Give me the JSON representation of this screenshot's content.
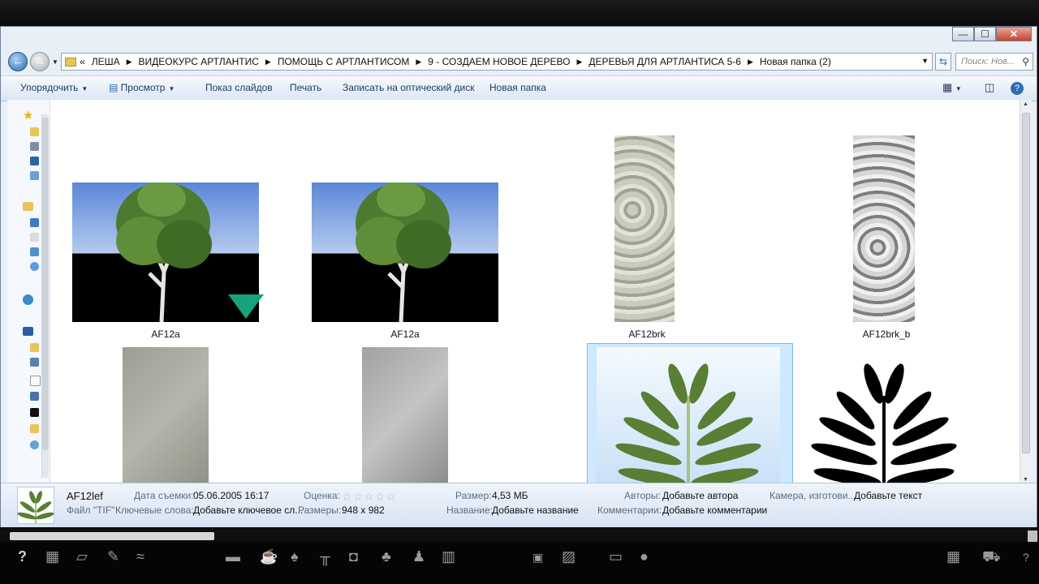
{
  "window": {
    "controls": {
      "minimize": "—",
      "maximize": "☐",
      "close": "✕"
    }
  },
  "address_bar": {
    "prefix": "«",
    "crumbs": [
      "ЛЕША",
      "ВИДЕОКУРС  АРТЛАНТИС",
      "ПОМОЩЬ С АРТЛАНТИСОМ",
      "9 - СОЗДАЕМ НОВОЕ ДЕРЕВО",
      "ДЕРЕВЬЯ ДЛЯ АРТЛАНТИСА   5-6",
      "Новая папка (2)"
    ],
    "search_placeholder": "Поиск: Нов..."
  },
  "toolbar": {
    "organize": "Упорядочить",
    "view": "Просмотр",
    "slideshow": "Показ слайдов",
    "print": "Печать",
    "burn": "Записать на оптический диск",
    "new_folder": "Новая папка"
  },
  "files": [
    {
      "name": "AF12a",
      "kind": "tree",
      "badge": true
    },
    {
      "name": "AF12a",
      "kind": "tree",
      "badge": false
    },
    {
      "name": "AF12brk",
      "kind": "bark-color"
    },
    {
      "name": "AF12brk_b",
      "kind": "bark-gray"
    },
    {
      "name": "",
      "kind": "bark-flat"
    },
    {
      "name": "",
      "kind": "bark-flat-gray"
    },
    {
      "name": "",
      "kind": "leaf-color",
      "selected": true
    },
    {
      "name": "",
      "kind": "leaf-mask"
    }
  ],
  "details": {
    "filename": "AF12lef",
    "filetype": "Файл \"TIF\"",
    "date_label": "Дата съемки:",
    "date_value": "05.06.2005 16:17",
    "keywords_label": "Ключевые слова:",
    "keywords_value": "Добавьте ключевое сл...",
    "rating_label": "Оценка:",
    "rating_value": 0,
    "dimensions_label": "Размеры:",
    "dimensions_value": "948 x 982",
    "size_label": "Размер:",
    "size_value": "4,53 МБ",
    "title_label": "Название:",
    "title_value": "Добавьте название",
    "authors_label": "Авторы:",
    "authors_value": "Добавьте автора",
    "comments_label": "Комментарии:",
    "comments_value": "Добавьте комментарии",
    "camera_label": "Камера, изготови...",
    "camera_value": "Добавьте текст"
  },
  "colors": {
    "selection": "#cde8ff",
    "sky": "#5b86d8",
    "accent": "#2f6eb0"
  }
}
